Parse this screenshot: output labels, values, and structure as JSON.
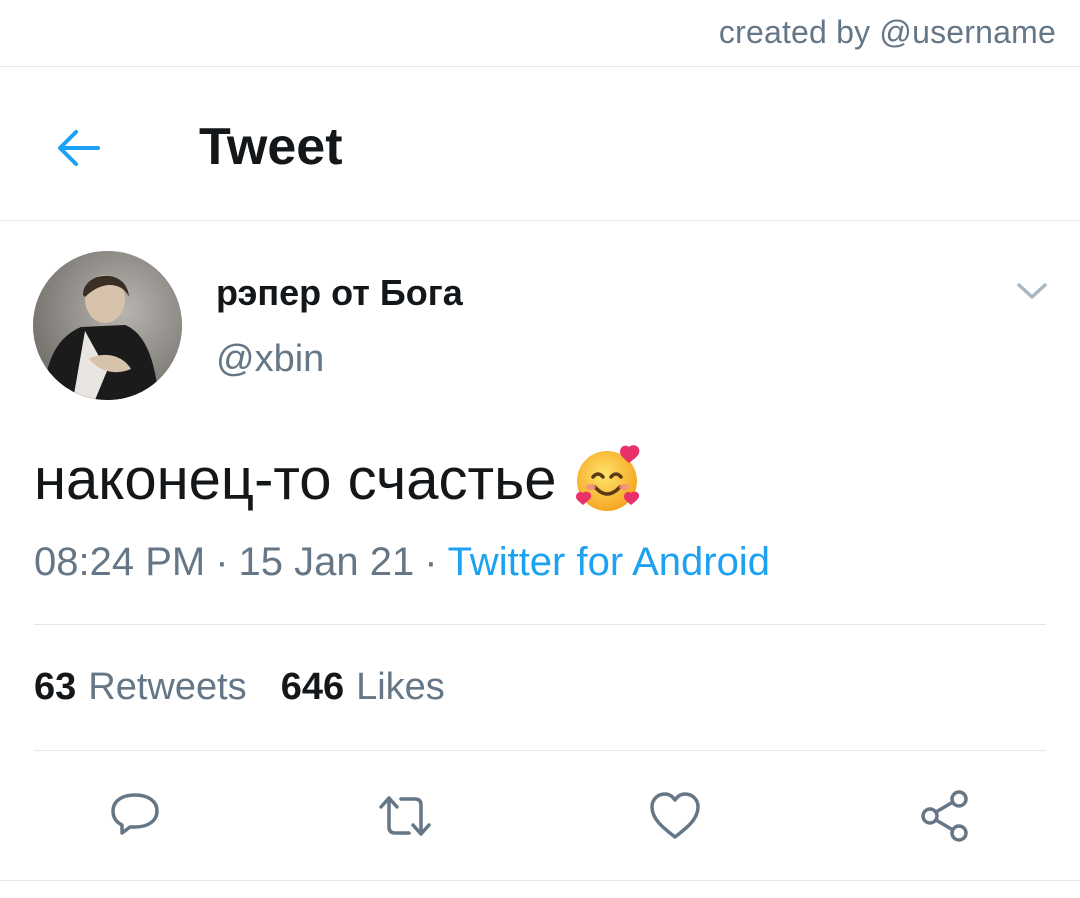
{
  "credit": "created by @username",
  "header": {
    "back_icon": "arrow-left-icon",
    "title": "Tweet"
  },
  "tweet": {
    "display_name": "рэпер от Бога",
    "handle": "@xbin",
    "more_icon": "chevron-down-icon",
    "text": "наконец-то счастье",
    "emoji": "smiling-face-with-hearts",
    "time": "08:24 PM",
    "date": "15 Jan 21",
    "separator": "·",
    "source": "Twitter for Android",
    "retweets_count": "63",
    "retweets_label": "Retweets",
    "likes_count": "646",
    "likes_label": "Likes"
  },
  "actions": [
    {
      "icon": "reply-icon"
    },
    {
      "icon": "retweet-icon"
    },
    {
      "icon": "like-icon"
    },
    {
      "icon": "share-icon"
    }
  ],
  "colors": {
    "accent": "#1da1f2",
    "text": "#14171a",
    "secondary": "#657786",
    "divider": "#e1e8ed",
    "icon": "#657786"
  }
}
